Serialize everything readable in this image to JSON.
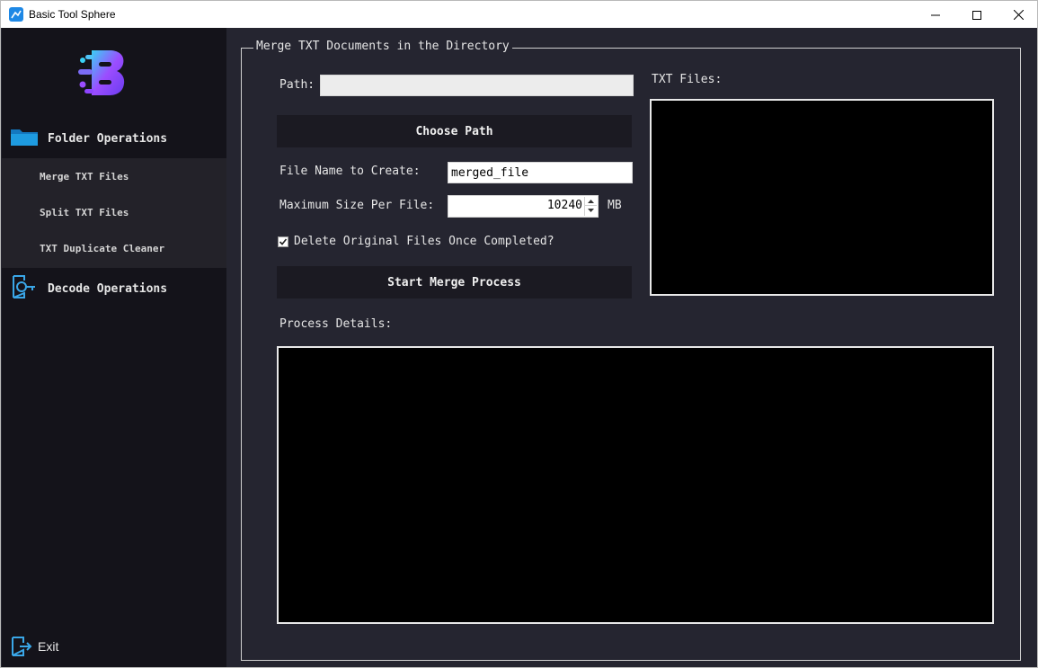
{
  "window": {
    "title": "Basic Tool Sphere",
    "icons": {
      "app": "app-icon",
      "minimize": "minimize-icon",
      "maximize": "maximize-icon",
      "close": "close-icon"
    }
  },
  "sidebar": {
    "logo": "logo-icon",
    "sections": [
      {
        "label": "Folder Operations",
        "icon": "folder-icon"
      },
      {
        "label": "Decode Operations",
        "icon": "key-icon"
      }
    ],
    "folder_items": [
      {
        "label": "Merge TXT Files"
      },
      {
        "label": "Split TXT Files"
      },
      {
        "label": "TXT Duplicate Cleaner"
      }
    ],
    "exit": {
      "label": "Exit",
      "icon": "exit-icon"
    }
  },
  "main": {
    "group_title": "Merge TXT Documents in the Directory",
    "path": {
      "label": "Path:",
      "value": ""
    },
    "choose_path_button": "Choose Path",
    "file_name": {
      "label": "File Name to Create:",
      "value": "merged_file"
    },
    "max_size": {
      "label": "Maximum Size Per File:",
      "value": "10240",
      "unit": "MB"
    },
    "delete_original": {
      "label": "Delete Original Files Once Completed?",
      "checked": true
    },
    "start_button": "Start Merge Process",
    "txt_files": {
      "label": "TXT Files:",
      "items": []
    },
    "process_details": {
      "label": "Process Details:",
      "lines": []
    }
  },
  "colors": {
    "window_bg": "#252530",
    "sidebar_bg": "#14131a",
    "submenu_bg": "#232229",
    "button_bg": "#1b1a22",
    "folder_icon": "#1e9be0",
    "logo_gradient": [
      "#3ad0f5",
      "#9b4dff",
      "#6a3cf0"
    ]
  }
}
